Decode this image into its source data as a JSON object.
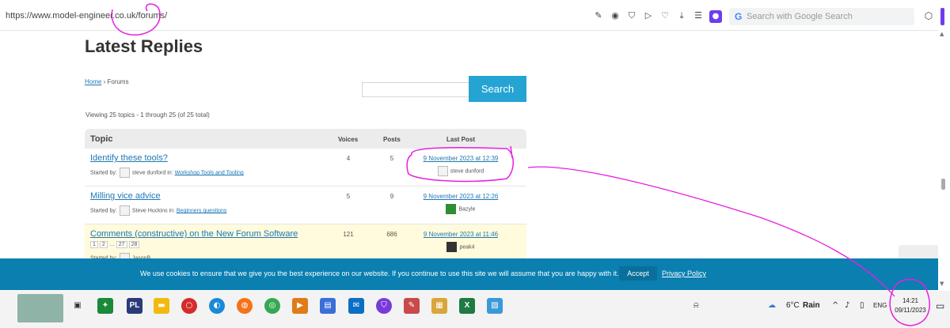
{
  "browser": {
    "url": "https://www.model-engineer.co.uk/forums/",
    "search_placeholder": "Search with Google Search",
    "google_letter": "G"
  },
  "page": {
    "heading": "Latest Replies",
    "breadcrumb_home": "Home",
    "breadcrumb_sep": "›",
    "breadcrumb_current": "Forums",
    "search_button": "Search",
    "viewing": "Viewing 25 topics - 1 through 25 (of 25 total)"
  },
  "table": {
    "headers": {
      "topic": "Topic",
      "voices": "Voices",
      "posts": "Posts",
      "last_post": "Last Post"
    },
    "rows": [
      {
        "title": "Identify these tools?",
        "started_by": "Started by:",
        "author": "steve dunford",
        "in_label": "in:",
        "forum": "Workshop Tools and Tooling",
        "voices": "4",
        "posts": "5",
        "last_post": "9 November 2023 at 12:39",
        "last_user": "steve dunford"
      },
      {
        "title": "Milling vice advice",
        "started_by": "Started by:",
        "author": "Steve Huckins",
        "in_label": "in:",
        "forum": "Beginners questions",
        "voices": "5",
        "posts": "9",
        "last_post": "9 November 2023 at 12:26",
        "last_user": "Bazyle"
      },
      {
        "title": "Comments (constructive) on the New Forum Software",
        "started_by": "Started by:",
        "author": "JasonB",
        "voices": "121",
        "posts": "686",
        "last_post": "9 November 2023 at 11:46",
        "last_user": "peak4",
        "pages": [
          "1",
          "2",
          "…",
          "27",
          "28"
        ]
      }
    ]
  },
  "cookie": {
    "message": "We use cookies to ensure that we give you the best experience on our website. If you continue to use this site we will assume that you are happy with it.",
    "accept": "Accept",
    "privacy": "Privacy Policy"
  },
  "taskbar": {
    "weather_temp": "6°C",
    "weather_text": "Rain",
    "language": "ENG",
    "time": "14:21",
    "date": "09/11/2023",
    "pl_label": "PL",
    "excel_label": "X"
  },
  "colors": {
    "accent": "#25a4d3",
    "cookie_bg": "#0a7fb0",
    "link": "#1e77b4",
    "annotation": "#e81ee0",
    "profile": "#6d3cf0"
  }
}
